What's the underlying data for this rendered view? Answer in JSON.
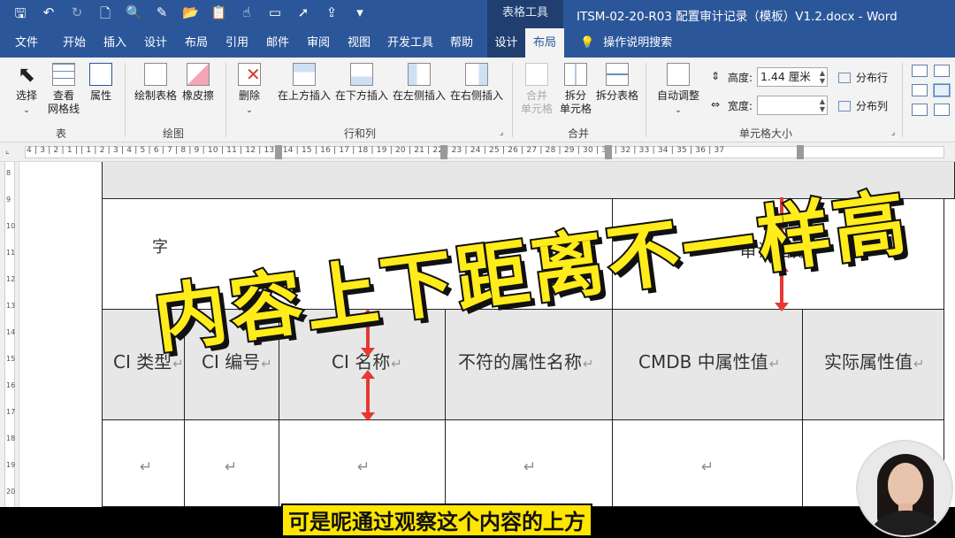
{
  "titlebar": {
    "context_group": "表格工具",
    "document_title": "ITSM-02-20-R03 配置审计记录（模板）V1.2.docx - Word",
    "qat_icons": [
      "save-icon",
      "undo-icon",
      "redo-icon",
      "new-doc-icon",
      "print-preview-icon",
      "format-painter-icon",
      "open-icon",
      "paste-icon",
      "touch-mode-icon",
      "screen-icon",
      "send-icon",
      "export-icon",
      "customize-icon"
    ]
  },
  "tabs": [
    {
      "label": "文件"
    },
    {
      "label": "开始"
    },
    {
      "label": "插入"
    },
    {
      "label": "设计"
    },
    {
      "label": "布局"
    },
    {
      "label": "引用"
    },
    {
      "label": "邮件"
    },
    {
      "label": "审阅"
    },
    {
      "label": "视图"
    },
    {
      "label": "开发工具"
    },
    {
      "label": "帮助"
    },
    {
      "label": "设计"
    },
    {
      "label": "布局"
    }
  ],
  "tell_me": "操作说明搜索",
  "ribbon": {
    "table_group": {
      "label": "表",
      "select": "选择",
      "gridlines_1": "查看",
      "gridlines_2": "网格线",
      "properties": "属性"
    },
    "draw_group": {
      "label": "绘图",
      "draw_table": "绘制表格",
      "eraser": "橡皮擦"
    },
    "rows_group": {
      "label": "行和列",
      "delete": "删除",
      "insert_above": "在上方插入",
      "insert_below": "在下方插入",
      "insert_left": "在左侧插入",
      "insert_right": "在右侧插入"
    },
    "merge_group": {
      "label": "合并",
      "merge_1": "合并",
      "merge_2": "单元格",
      "split_cells_1": "拆分",
      "split_cells_2": "单元格",
      "split_table": "拆分表格"
    },
    "cell_size_group": {
      "label": "单元格大小",
      "autofit": "自动调整",
      "height_label": "高度:",
      "height_value": "1.44 厘米",
      "width_label": "宽度:",
      "width_value": "",
      "distribute_rows": "分布行",
      "distribute_cols": "分布列"
    }
  },
  "ruler": {
    "horizontal": "4 | 3 | 2 | 1 |   | 1 | 2 | 3 | 4 | 5 | 6 | 7 | 8 | 9 | 10 | 11 | 12 | 13 | 14 | 15 | 16 | 17 | 18 | 19 | 20 | 21 | 22 | 23 | 24 | 25 | 26 | 27 | 28 | 29 | 30 | 31 | 32 | 33 | 34 | 35 | 36 | 37",
    "vertical": [
      "8",
      "9",
      "10",
      "11",
      "12",
      "13",
      "14",
      "15",
      "16",
      "17",
      "18",
      "19",
      "20"
    ]
  },
  "document": {
    "partial_cell_text": "字",
    "audit_date": "审计日期",
    "headers": [
      "CI 类型",
      "CI 编号",
      "CI 名称",
      "不符的属性名称",
      "CMDB 中属性值",
      "实际属性值"
    ],
    "return_mark": "↵"
  },
  "overlay": {
    "headline": "内容上下距离不一样高",
    "subtitle": "可是呢通过观察这个内容的上方"
  }
}
